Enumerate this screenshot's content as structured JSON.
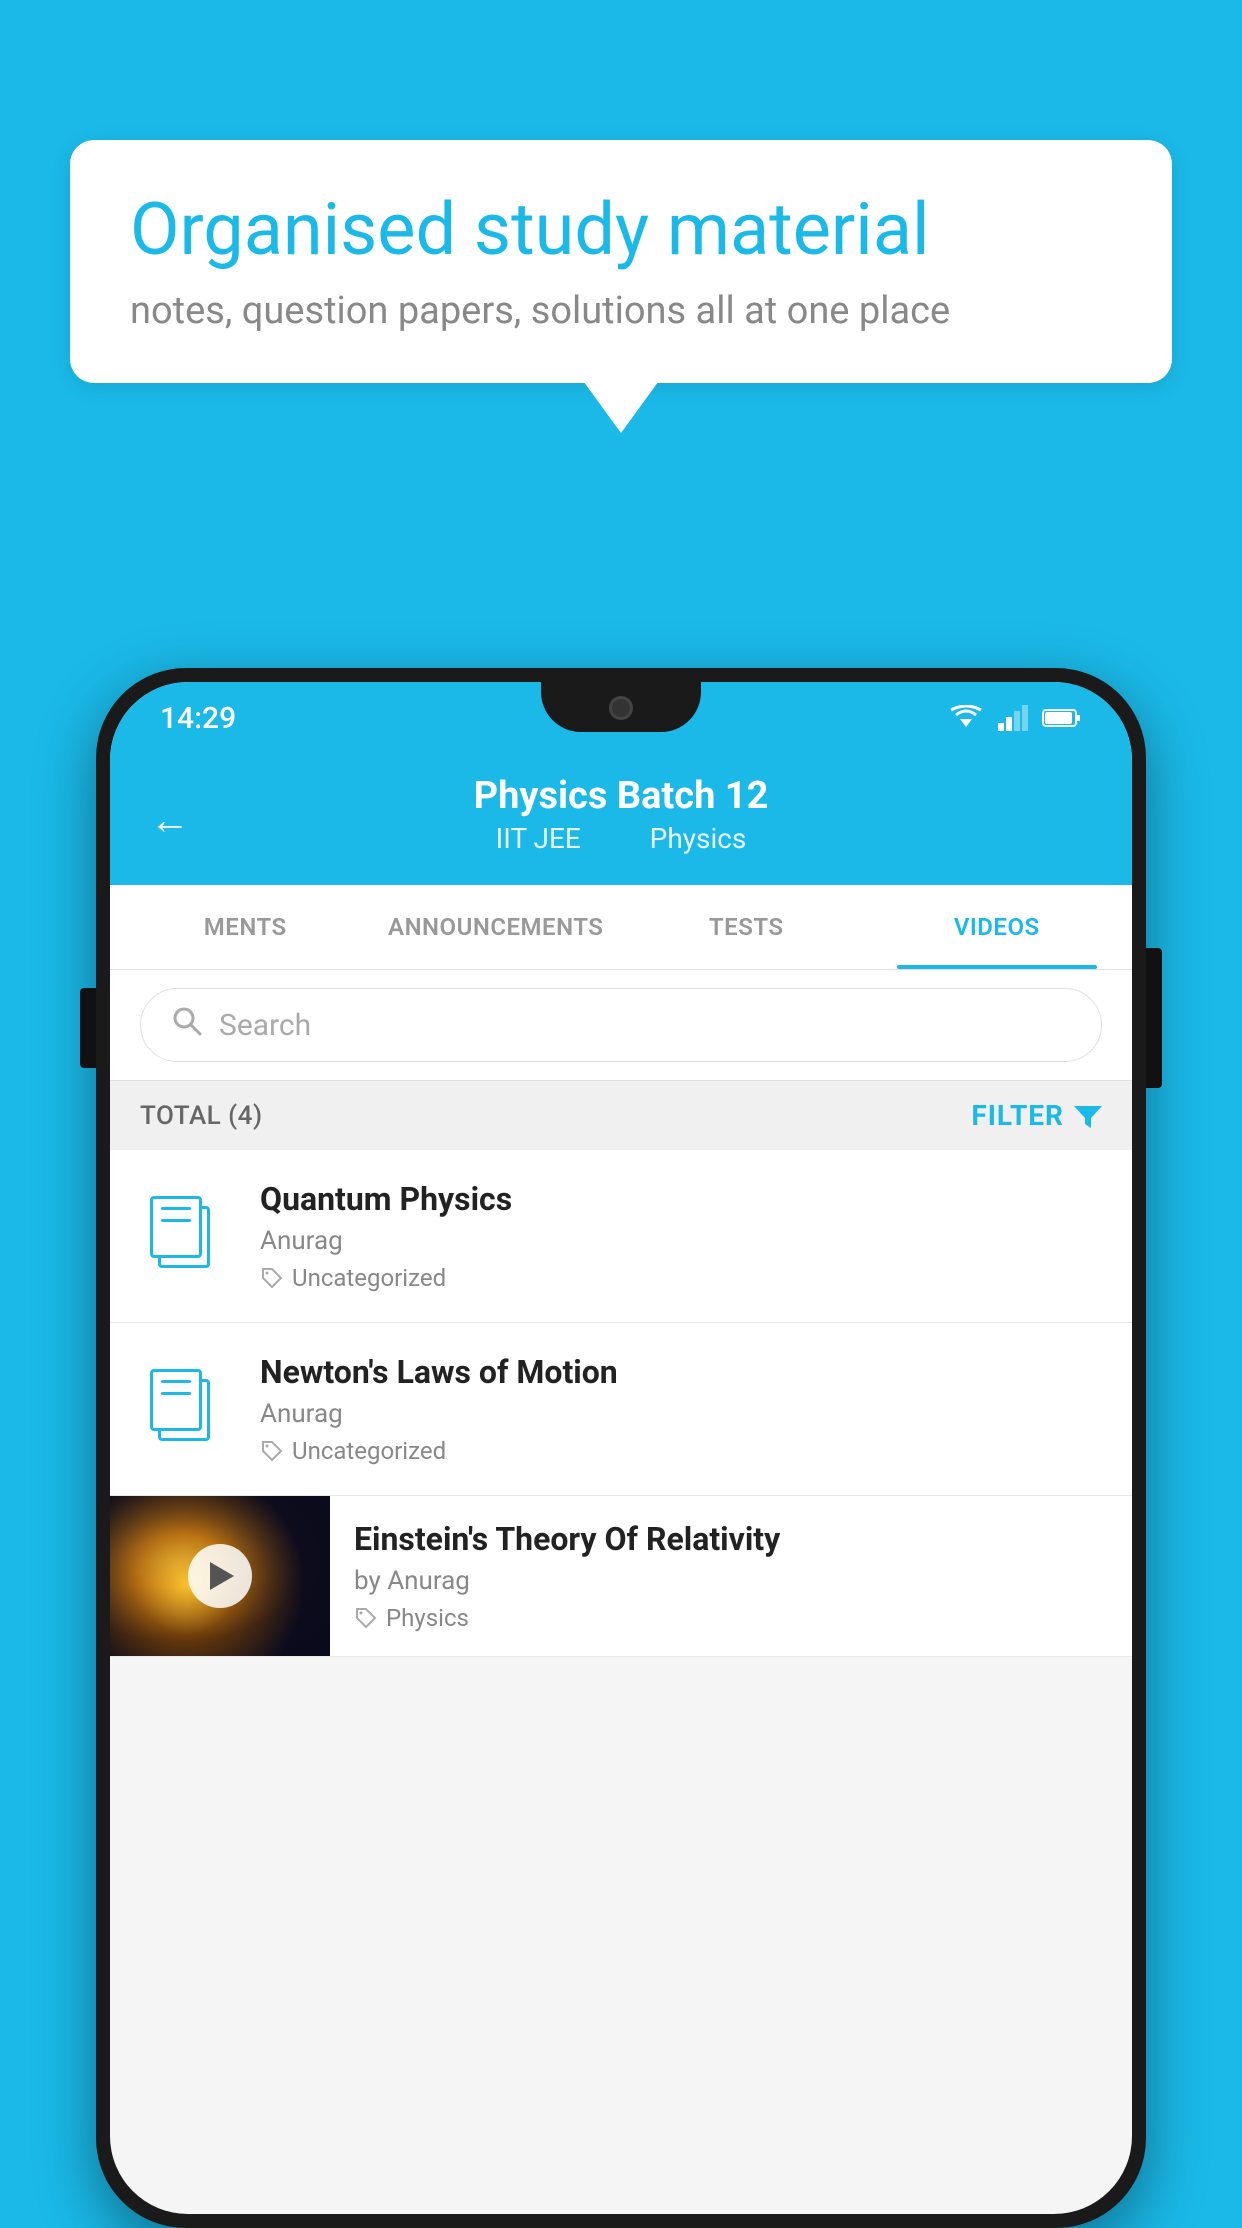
{
  "background_color": "#1ab9e8",
  "speech_bubble": {
    "heading": "Organised study material",
    "subtext": "notes, question papers, solutions all at one place"
  },
  "status_bar": {
    "time": "14:29"
  },
  "app_header": {
    "title": "Physics Batch 12",
    "subtitle_part1": "IIT JEE",
    "subtitle_part2": "Physics",
    "back_label": "←"
  },
  "tabs": [
    {
      "label": "MENTS",
      "active": false
    },
    {
      "label": "ANNOUNCEMENTS",
      "active": false
    },
    {
      "label": "TESTS",
      "active": false
    },
    {
      "label": "VIDEOS",
      "active": true
    }
  ],
  "search": {
    "placeholder": "Search"
  },
  "filter_row": {
    "total_label": "TOTAL (4)",
    "filter_label": "FILTER"
  },
  "videos": [
    {
      "id": 1,
      "title": "Quantum Physics",
      "author": "Anurag",
      "tag": "Uncategorized",
      "type": "file",
      "has_thumb": false
    },
    {
      "id": 2,
      "title": "Newton's Laws of Motion",
      "author": "Anurag",
      "tag": "Uncategorized",
      "type": "file",
      "has_thumb": false
    },
    {
      "id": 3,
      "title": "Einstein's Theory Of Relativity",
      "author": "by Anurag",
      "tag": "Physics",
      "type": "video",
      "has_thumb": true
    }
  ],
  "icons": {
    "tag_symbol": "🏷",
    "filter_symbol": "▼"
  }
}
